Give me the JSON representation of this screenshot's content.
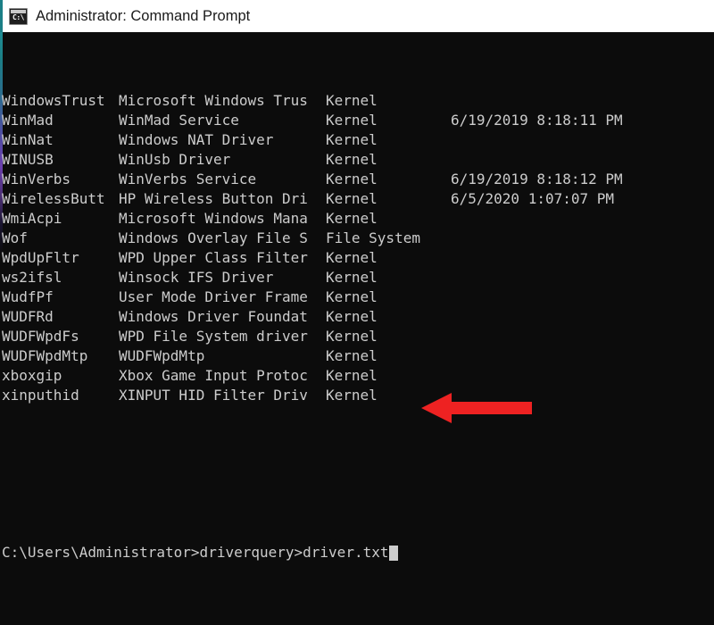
{
  "window": {
    "title": "Administrator: Command Prompt",
    "icon": "console-icon",
    "icon_glyph": "C:\\",
    "accent_color": "#1b7f86",
    "titlebar_bg": "#ffffff",
    "terminal_bg": "#0c0c0c",
    "terminal_fg": "#cccccc"
  },
  "terminal": {
    "rows": [
      {
        "name": "WindowsTrust",
        "description": "Microsoft Windows Trus",
        "type": "Kernel",
        "date": ""
      },
      {
        "name": "WinMad",
        "description": "WinMad Service",
        "type": "Kernel",
        "date": "6/19/2019 8:18:11 PM"
      },
      {
        "name": "WinNat",
        "description": "Windows NAT Driver",
        "type": "Kernel",
        "date": ""
      },
      {
        "name": "WINUSB",
        "description": "WinUsb Driver",
        "type": "Kernel",
        "date": ""
      },
      {
        "name": "WinVerbs",
        "description": "WinVerbs Service",
        "type": "Kernel",
        "date": "6/19/2019 8:18:12 PM"
      },
      {
        "name": "WirelessButt",
        "description": "HP Wireless Button Dri",
        "type": "Kernel",
        "date": "6/5/2020 1:07:07 PM"
      },
      {
        "name": "WmiAcpi",
        "description": "Microsoft Windows Mana",
        "type": "Kernel",
        "date": ""
      },
      {
        "name": "Wof",
        "description": "Windows Overlay File S",
        "type": "File System",
        "date": ""
      },
      {
        "name": "WpdUpFltr",
        "description": "WPD Upper Class Filter",
        "type": "Kernel",
        "date": ""
      },
      {
        "name": "ws2ifsl",
        "description": "Winsock IFS Driver",
        "type": "Kernel",
        "date": ""
      },
      {
        "name": "WudfPf",
        "description": "User Mode Driver Frame",
        "type": "Kernel",
        "date": ""
      },
      {
        "name": "WUDFRd",
        "description": "Windows Driver Foundat",
        "type": "Kernel",
        "date": ""
      },
      {
        "name": "WUDFWpdFs",
        "description": "WPD File System driver",
        "type": "Kernel",
        "date": ""
      },
      {
        "name": "WUDFWpdMtp",
        "description": "WUDFWpdMtp",
        "type": "Kernel",
        "date": ""
      },
      {
        "name": "xboxgip",
        "description": "Xbox Game Input Protoc",
        "type": "Kernel",
        "date": ""
      },
      {
        "name": "xinputhid",
        "description": "XINPUT HID Filter Driv",
        "type": "Kernel",
        "date": ""
      }
    ],
    "prompt": {
      "path": "C:\\Users\\Administrator>",
      "command": "driverquery>driver.txt",
      "full_line": "C:\\Users\\Administrator>driverquery>driver.txt",
      "cursor": "block"
    }
  },
  "annotation": {
    "arrow": {
      "name": "red-arrow-annotation",
      "direction": "left",
      "color": "#ee2222"
    }
  }
}
